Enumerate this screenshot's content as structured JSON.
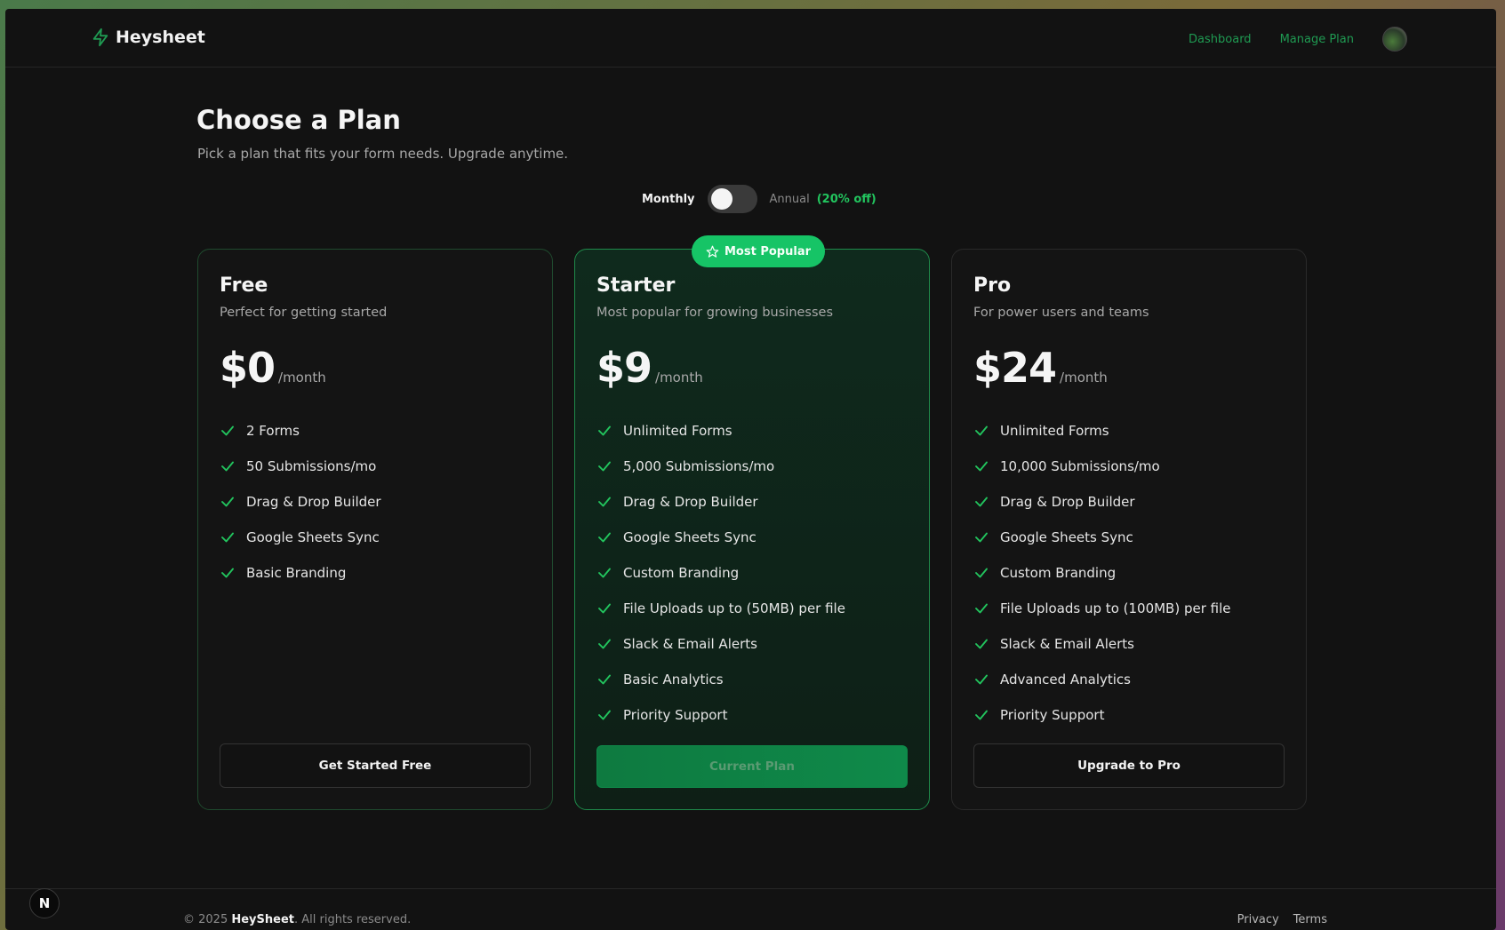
{
  "header": {
    "brand": "Heysheet",
    "nav": {
      "dashboard": "Dashboard",
      "manage_plan": "Manage Plan"
    }
  },
  "page": {
    "title": "Choose a Plan",
    "subtitle": "Pick a plan that fits your form needs. Upgrade anytime."
  },
  "billing": {
    "monthly_label": "Monthly",
    "annual_label": "Annual",
    "discount_label": "(20% off)",
    "annual_selected": false
  },
  "plans": [
    {
      "name": "Free",
      "description": "Perfect for getting started",
      "price": "$0",
      "period": "/month",
      "features": [
        "2 Forms",
        "50 Submissions/mo",
        "Drag & Drop Builder",
        "Google Sheets Sync",
        "Basic Branding"
      ],
      "cta": "Get Started Free"
    },
    {
      "name": "Starter",
      "badge": "Most Popular",
      "description": "Most popular for growing businesses",
      "price": "$9",
      "period": "/month",
      "features": [
        "Unlimited Forms",
        "5,000 Submissions/mo",
        "Drag & Drop Builder",
        "Google Sheets Sync",
        "Custom Branding",
        "File Uploads up to (50MB) per file",
        "Slack & Email Alerts",
        "Basic Analytics",
        "Priority Support"
      ],
      "cta": "Current Plan"
    },
    {
      "name": "Pro",
      "description": "For power users and teams",
      "price": "$24",
      "period": "/month",
      "features": [
        "Unlimited Forms",
        "10,000 Submissions/mo",
        "Drag & Drop Builder",
        "Google Sheets Sync",
        "Custom Branding",
        "File Uploads up to (100MB) per file",
        "Slack & Email Alerts",
        "Advanced Analytics",
        "Priority Support"
      ],
      "cta": "Upgrade to Pro"
    }
  ],
  "footer": {
    "copyright_prefix": "© 2025",
    "copyright_brand": "HeySheet",
    "copyright_suffix": ". All rights reserved.",
    "links": {
      "privacy": "Privacy",
      "terms": "Terms"
    }
  },
  "dev_badge": "N",
  "colors": {
    "accent": "#22c55e",
    "accent_dark": "#0f8a4a",
    "background": "#121212"
  },
  "icons": {
    "brand": "lightning-icon",
    "check": "check-icon",
    "badge": "star-icon"
  }
}
